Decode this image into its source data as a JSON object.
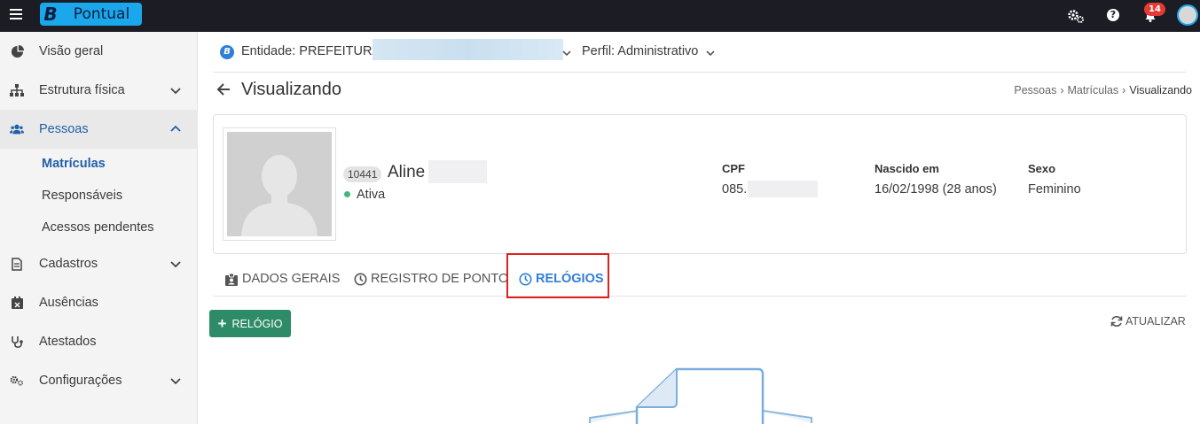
{
  "app": {
    "brand_letter": "B",
    "brand_name": "Pontual"
  },
  "topbar": {
    "notifications_count": "14",
    "help_glyph": "?"
  },
  "sidebar": {
    "items": [
      {
        "label": "Visão geral",
        "icon": "pie-chart-icon"
      },
      {
        "label": "Estrutura física",
        "icon": "sitemap-icon"
      },
      {
        "label": "Pessoas",
        "icon": "users-icon"
      },
      {
        "label": "Cadastros",
        "icon": "file-icon"
      },
      {
        "label": "Ausências",
        "icon": "calendar-x-icon"
      },
      {
        "label": "Atestados",
        "icon": "stethoscope-icon"
      },
      {
        "label": "Configurações",
        "icon": "gears-icon"
      }
    ],
    "subitems": [
      "Matrículas",
      "Responsáveis",
      "Acessos pendentes"
    ]
  },
  "entity_bar": {
    "entity_label": "Entidade: PREFEITURA",
    "profile_label": "Perfil: Administrativo"
  },
  "page": {
    "title": "Visualizando",
    "breadcrumb": [
      "Pessoas",
      "Matrículas",
      "Visualizando"
    ]
  },
  "person": {
    "id": "10441",
    "name": "Aline",
    "status": "Ativa",
    "cpf_label": "CPF",
    "cpf_value": "085.",
    "birth_label": "Nascido em",
    "birth_value": "16/02/1998 (28 anos)",
    "sex_label": "Sexo",
    "sex_value": "Feminino"
  },
  "tabs": [
    {
      "label": "DADOS GERAIS"
    },
    {
      "label": "REGISTRO DE PONTO"
    },
    {
      "label": "RELÓGIOS"
    }
  ],
  "actions": {
    "add_label": "RELÓGIO",
    "refresh_label": "ATUALIZAR"
  },
  "colors": {
    "accent": "#2f7fd6",
    "primary_button": "#2e8b67",
    "topbar": "#1c1c24",
    "highlight": "#e02020"
  }
}
